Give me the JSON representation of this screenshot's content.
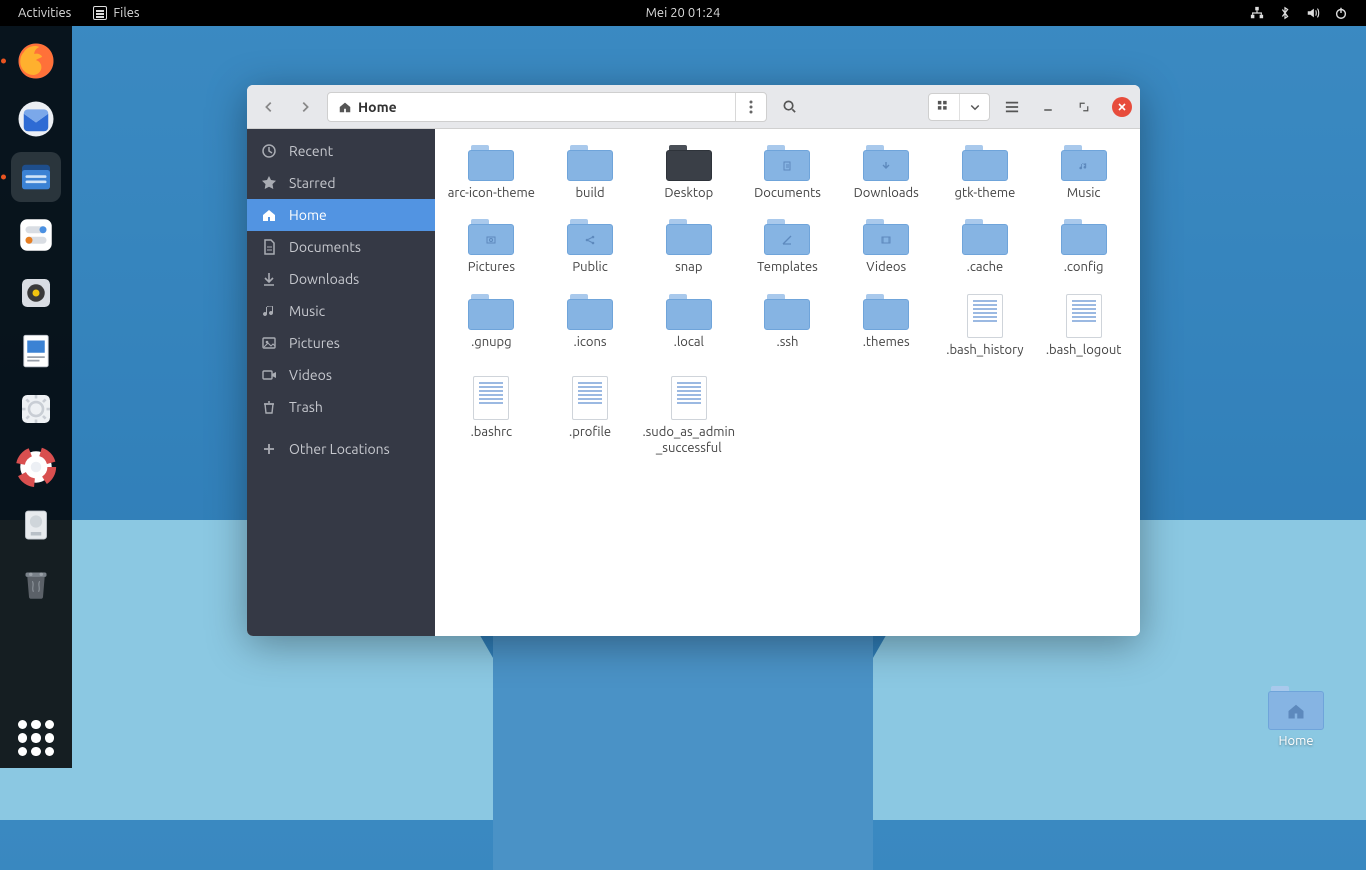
{
  "topbar": {
    "activities": "Activities",
    "app_label": "Files",
    "clock": "Mei 20  01:24"
  },
  "desktop_icon": {
    "label": "Home"
  },
  "window": {
    "path": {
      "label": "Home"
    },
    "sidebar": [
      {
        "id": "recent",
        "label": "Recent",
        "icon": "clock"
      },
      {
        "id": "starred",
        "label": "Starred",
        "icon": "star"
      },
      {
        "id": "home",
        "label": "Home",
        "icon": "home",
        "selected": true
      },
      {
        "id": "documents",
        "label": "Documents",
        "icon": "doc"
      },
      {
        "id": "downloads",
        "label": "Downloads",
        "icon": "down"
      },
      {
        "id": "music",
        "label": "Music",
        "icon": "music"
      },
      {
        "id": "pictures",
        "label": "Pictures",
        "icon": "pic"
      },
      {
        "id": "videos",
        "label": "Videos",
        "icon": "vid"
      },
      {
        "id": "trash",
        "label": "Trash",
        "icon": "trash"
      },
      {
        "id": "other",
        "label": "Other Locations",
        "icon": "plus",
        "spaced": true
      }
    ],
    "items": [
      {
        "name": "arc-icon-theme",
        "type": "folder"
      },
      {
        "name": "build",
        "type": "folder"
      },
      {
        "name": "Desktop",
        "type": "folder-dark"
      },
      {
        "name": "Documents",
        "type": "folder",
        "glyph": "doc"
      },
      {
        "name": "Downloads",
        "type": "folder",
        "glyph": "down"
      },
      {
        "name": "gtk-theme",
        "type": "folder"
      },
      {
        "name": "Music",
        "type": "folder",
        "glyph": "music"
      },
      {
        "name": "Pictures",
        "type": "folder",
        "glyph": "pic"
      },
      {
        "name": "Public",
        "type": "folder",
        "glyph": "share"
      },
      {
        "name": "snap",
        "type": "folder"
      },
      {
        "name": "Templates",
        "type": "folder",
        "glyph": "tmpl"
      },
      {
        "name": "Videos",
        "type": "folder",
        "glyph": "vid"
      },
      {
        "name": ".cache",
        "type": "folder"
      },
      {
        "name": ".config",
        "type": "folder"
      },
      {
        "name": ".gnupg",
        "type": "folder"
      },
      {
        "name": ".icons",
        "type": "folder"
      },
      {
        "name": ".local",
        "type": "folder"
      },
      {
        "name": ".ssh",
        "type": "folder"
      },
      {
        "name": ".themes",
        "type": "folder"
      },
      {
        "name": ".bash_history",
        "type": "text"
      },
      {
        "name": ".bash_logout",
        "type": "text"
      },
      {
        "name": ".bashrc",
        "type": "text"
      },
      {
        "name": ".profile",
        "type": "text"
      },
      {
        "name": ".sudo_as_admin_successful",
        "type": "text"
      }
    ]
  }
}
